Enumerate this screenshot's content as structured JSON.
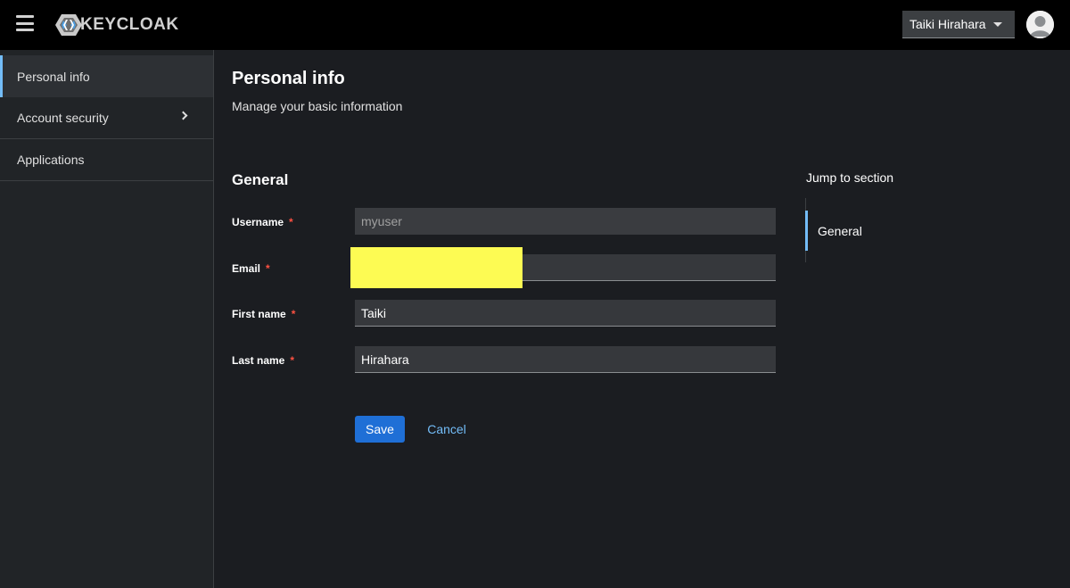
{
  "header": {
    "logo_text": "KEYCLOAK",
    "user_name": "Taiki Hirahara"
  },
  "sidebar": {
    "items": [
      {
        "label": "Personal info"
      },
      {
        "label": "Account security"
      },
      {
        "label": "Applications"
      }
    ]
  },
  "main": {
    "title": "Personal info",
    "subtitle": "Manage your basic information",
    "section_title": "General",
    "fields": [
      {
        "label": "Username",
        "required": "*",
        "value": "myuser"
      },
      {
        "label": "Email",
        "required": "*",
        "value": ""
      },
      {
        "label": "First name",
        "required": "*",
        "value": "Taiki"
      },
      {
        "label": "Last name",
        "required": "*",
        "value": "Hirahara"
      }
    ],
    "save_label": "Save",
    "cancel_label": "Cancel"
  },
  "jump": {
    "title": "Jump to section",
    "items": [
      {
        "label": "General"
      }
    ]
  },
  "colors": {
    "accent": "#73bcf7",
    "primary_button": "#1f6fd6",
    "required": "#fe5142",
    "redaction": "#fdfb53"
  }
}
